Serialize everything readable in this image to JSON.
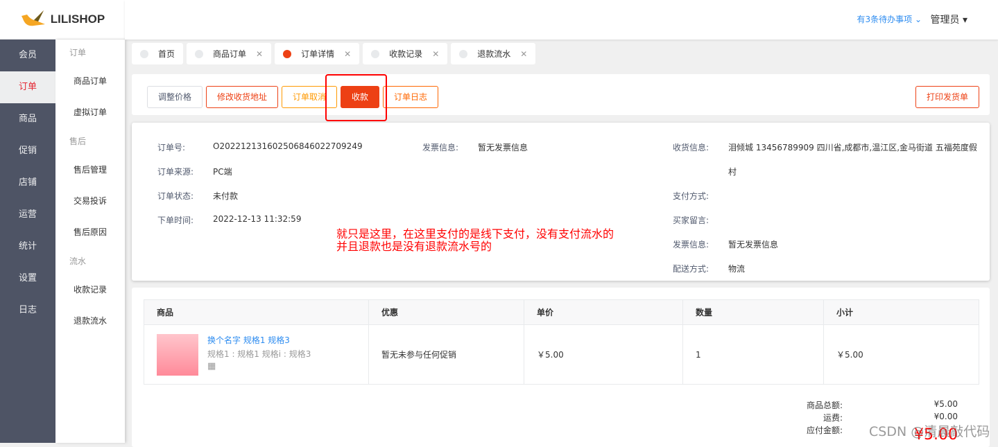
{
  "logo": "LILISHOP",
  "header": {
    "todo": "有3条待办事项",
    "admin": "管理员"
  },
  "nav1": [
    "会员",
    "订单",
    "商品",
    "促销",
    "店铺",
    "运营",
    "统计",
    "设置",
    "日志"
  ],
  "nav2": {
    "g1": "订单",
    "i1": "商品订单",
    "i2": "虚拟订单",
    "g2": "售后",
    "i3": "售后管理",
    "i4": "交易投诉",
    "i5": "售后原因",
    "g3": "流水",
    "i6": "收款记录",
    "i7": "退款流水"
  },
  "tabs": [
    "首页",
    "商品订单",
    "订单详情",
    "收款记录",
    "退款流水"
  ],
  "actions": {
    "adjust": "调整价格",
    "address": "修改收货地址",
    "cancel": "订单取消",
    "pay": "收款",
    "log": "订单日志",
    "print": "打印发货单"
  },
  "order": {
    "no_l": "订单号:",
    "no": "O202212131602506846022709249",
    "src_l": "订单来源:",
    "src": "PC端",
    "st_l": "订单状态:",
    "st": "未付款",
    "time_l": "下单时间:",
    "time": "2022-12-13 11:32:59",
    "inv_l": "发票信息:",
    "inv": "暂无发票信息",
    "recv_l": "收货信息:",
    "recv1": "泪倾城 13456789909 四川省,成都市,温江区,金马街道 五福苑度假",
    "recv2": "村",
    "paym_l": "支付方式:",
    "msg_l": "买家留言:",
    "inv2_l": "发票信息:",
    "inv2": "暂无发票信息",
    "ship_l": "配送方式:",
    "ship": "物流"
  },
  "note1": "就只是这里，在这里支付的是线下支付，没有支付流水的",
  "note2": "并且退款也是没有退款流水号的",
  "table": {
    "headers": [
      "商品",
      "优惠",
      "单价",
      "数量",
      "小计"
    ],
    "row": {
      "name": "换个名字 规格1 规格3",
      "spec": "规格1 : 规格1 规格i : 规格3",
      "promo": "暂无未参与任何促销",
      "price": "￥5.00",
      "qty": "1",
      "sub": "￥5.00"
    }
  },
  "summary": {
    "goods_l": "商品总额:",
    "goods": "¥5.00",
    "fee_l": "运费:",
    "fee": "¥0.00",
    "pay_l": "应付金额:",
    "pay": "¥5.00"
  },
  "watermark": "CSDN @清晨敲代码"
}
